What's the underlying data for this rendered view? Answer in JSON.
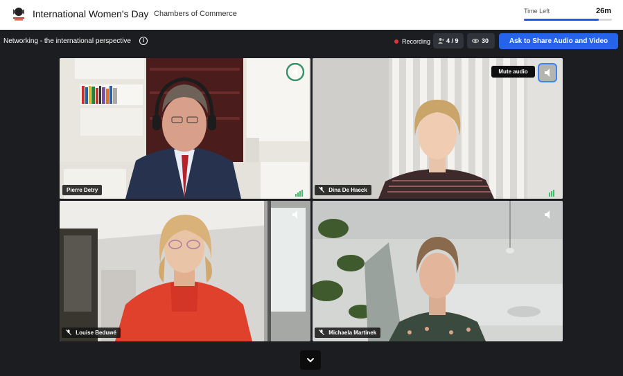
{
  "header": {
    "event_title": "International Women's Day",
    "organizer": "Chambers of Commerce",
    "time_left_label": "Time Left",
    "time_left_value": "26m",
    "time_left_fraction": 0.85
  },
  "session": {
    "title": "Networking - the international perspective",
    "recording_label": "Recording",
    "participants_count": "4 / 9",
    "viewers_count": "30",
    "share_button_label": "Ask to Share Audio and Video"
  },
  "colors": {
    "accent": "#2563eb",
    "recording": "#e0343b",
    "active_speaker_ring": "#3b8f6c",
    "hover_ring": "#3b82f6"
  },
  "tiles": [
    {
      "name": "Pierre Detry",
      "icon": "speaker-icon",
      "muted": false
    },
    {
      "name": "Dina De Haeck",
      "icon": "speaker-icon",
      "muted": true,
      "tooltip": "Mute audio"
    },
    {
      "name": "Louise Beduwé",
      "icon": "speaker-icon",
      "muted": true
    },
    {
      "name": "Michaela Martinek",
      "icon": "speaker-icon",
      "muted": true
    }
  ]
}
